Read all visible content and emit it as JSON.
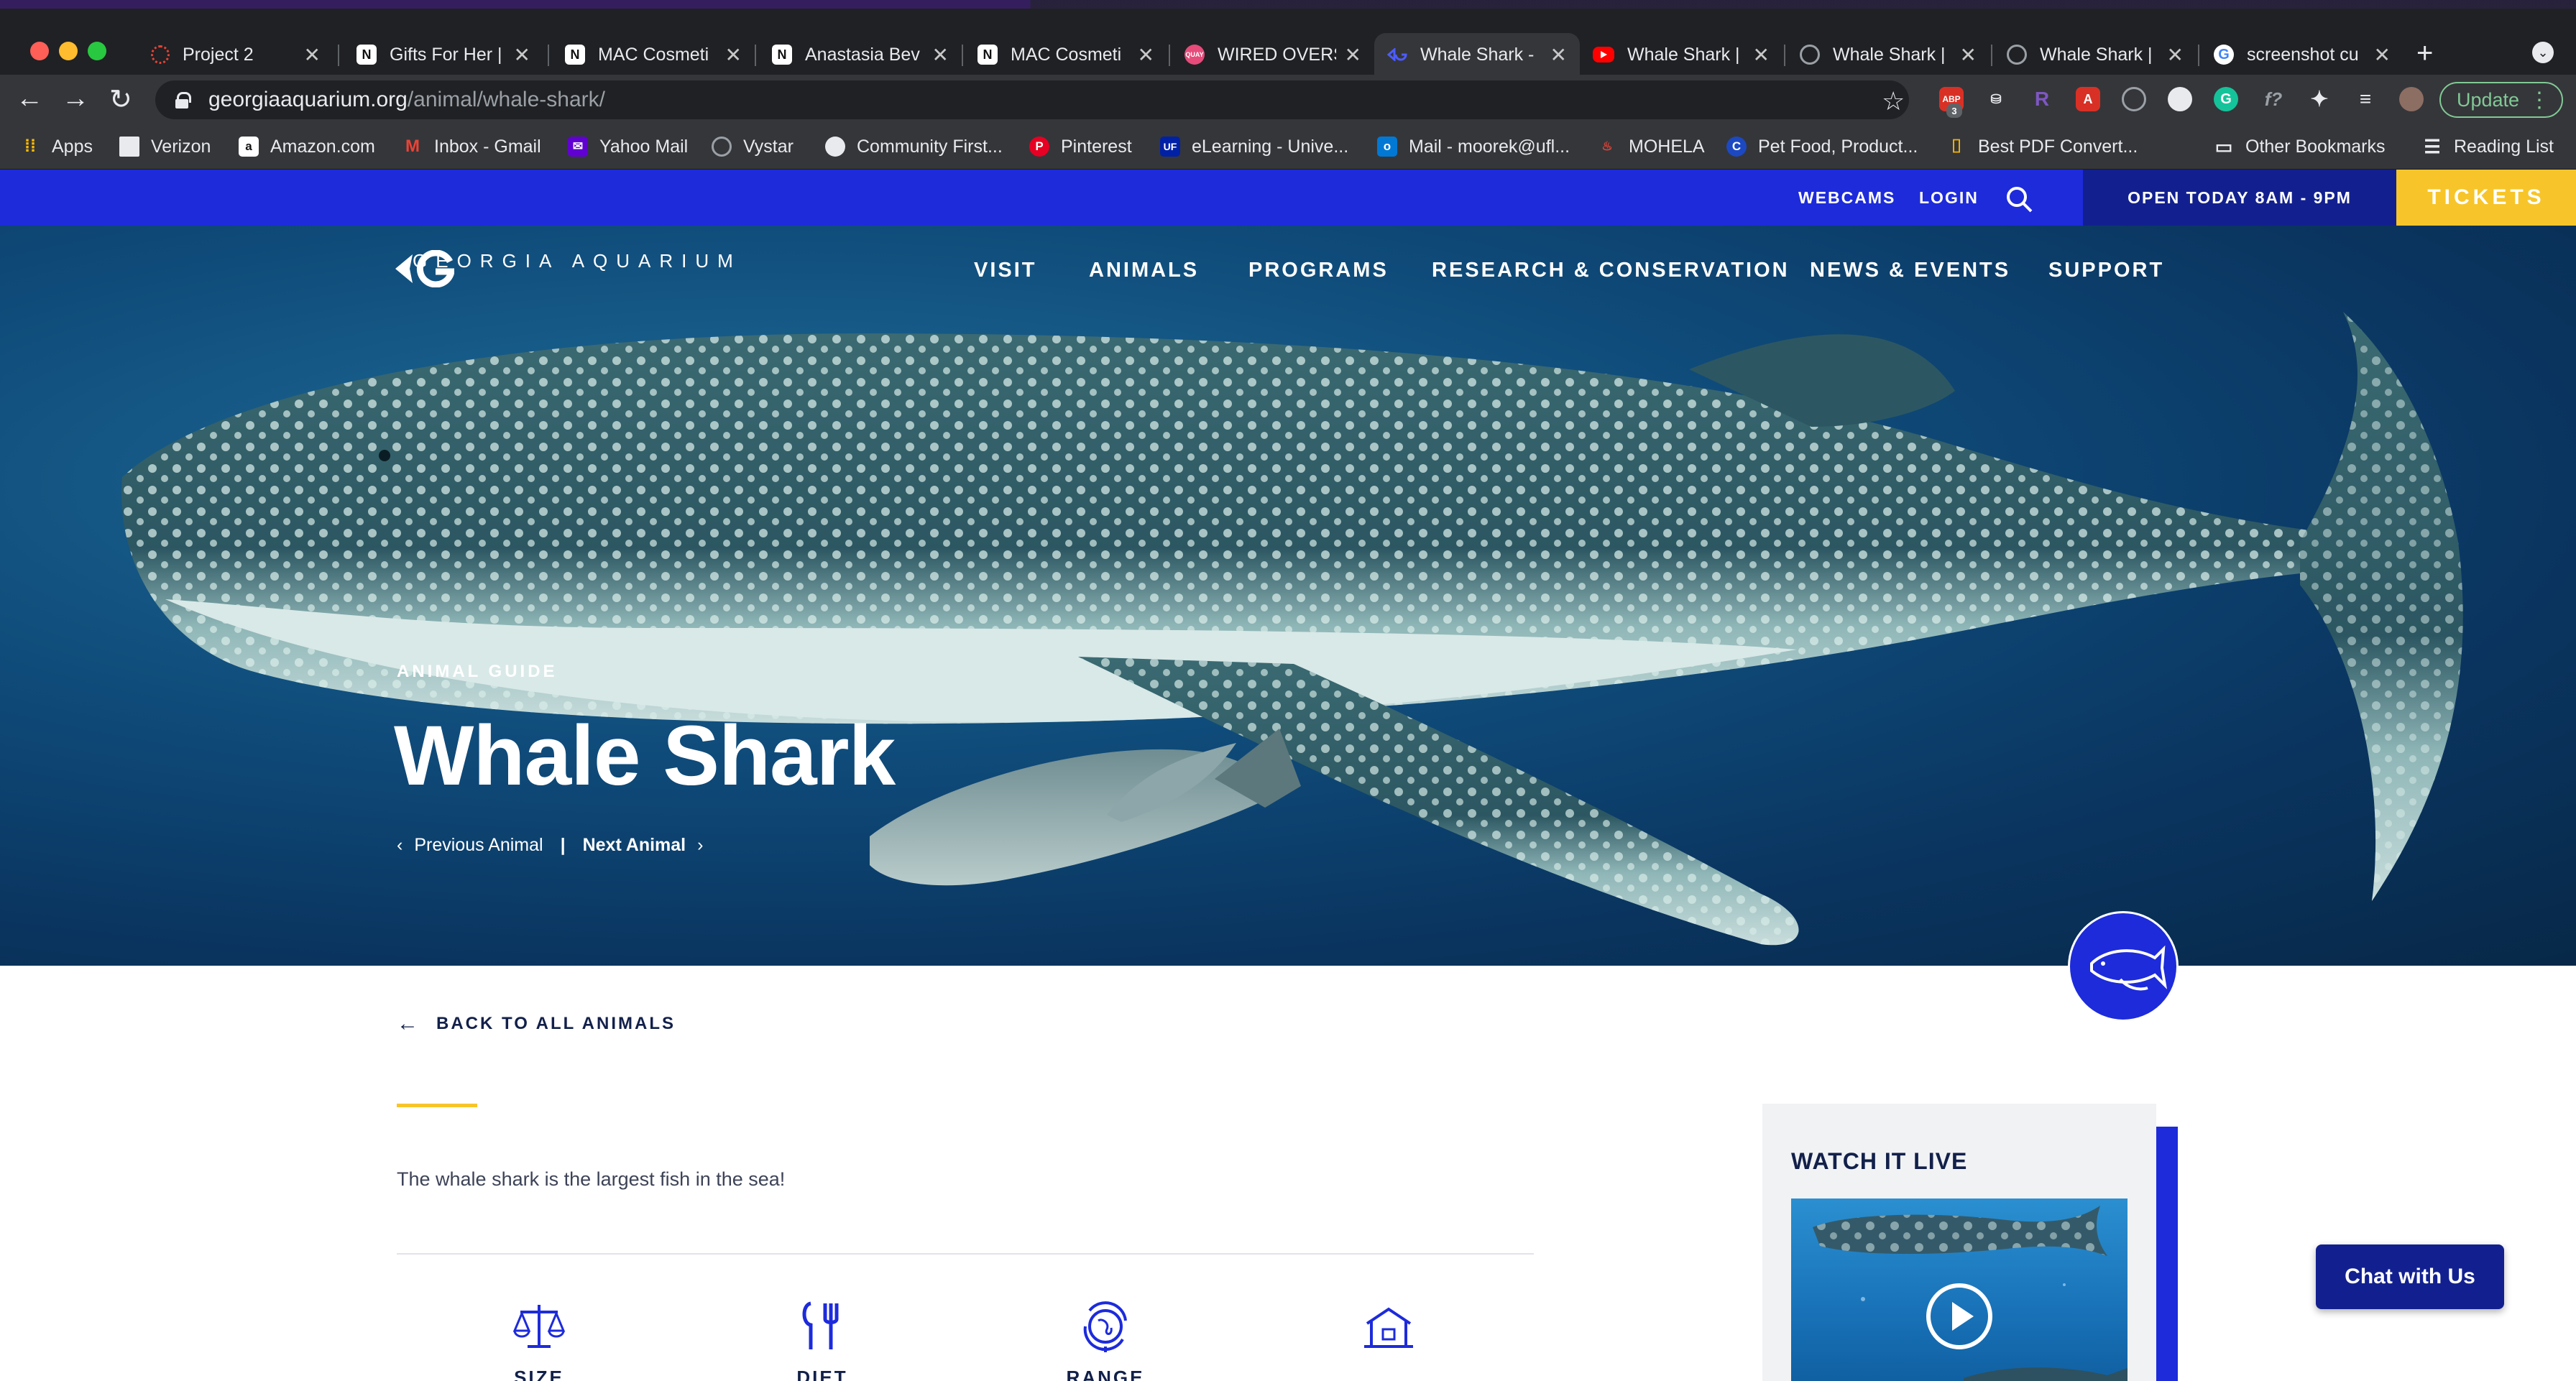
{
  "browser": {
    "tabs": [
      {
        "title": "Project 2",
        "favicon": "project-icon",
        "color": "#e94235",
        "active": false
      },
      {
        "title": "Gifts For Her |",
        "favicon": "N",
        "color": "#111111",
        "active": false
      },
      {
        "title": "MAC Cosmeti",
        "favicon": "N",
        "color": "#111111",
        "active": false
      },
      {
        "title": "Anastasia Bev",
        "favicon": "N",
        "color": "#111111",
        "active": false
      },
      {
        "title": "MAC Cosmeti",
        "favicon": "N",
        "color": "#111111",
        "active": false
      },
      {
        "title": "WIRED OVERS",
        "favicon": "QUAY",
        "color": "#e64b7a",
        "active": false
      },
      {
        "title": "Whale Shark -",
        "favicon": "ga-icon",
        "color": "#1d2bdb",
        "active": true
      },
      {
        "title": "Whale Shark |",
        "favicon": "youtube-icon",
        "color": "#ff0000",
        "active": false
      },
      {
        "title": "Whale Shark |",
        "favicon": "globe-icon",
        "color": "#9aa0a6",
        "active": false
      },
      {
        "title": "Whale Shark |",
        "favicon": "globe-icon",
        "color": "#9aa0a6",
        "active": false
      },
      {
        "title": "screenshot cu",
        "favicon": "google-icon",
        "color": "#4285f4",
        "active": false
      }
    ],
    "tab_close": "✕",
    "new_tab": "+",
    "url_host": "georgiaaquarium.org",
    "url_path": "/animal/whale-shark/",
    "update_label": "Update",
    "ext_badge": "3",
    "bookmarks": [
      {
        "label": "Apps",
        "icon": "apps-grid-icon",
        "color": "#4285f4"
      },
      {
        "label": "Verizon",
        "icon": "verizon-icon",
        "color": "#d52b1e"
      },
      {
        "label": "Amazon.com",
        "icon": "amazon-icon",
        "color": "#111111"
      },
      {
        "label": "Inbox - Gmail",
        "icon": "gmail-icon",
        "color": "#ea4335"
      },
      {
        "label": "Yahoo Mail",
        "icon": "yahoo-icon",
        "color": "#6001d2"
      },
      {
        "label": "Vystar",
        "icon": "vystar-icon",
        "color": "#5f6368"
      },
      {
        "label": "Community First...",
        "icon": "globe-icon",
        "color": "#5f6368"
      },
      {
        "label": "Pinterest",
        "icon": "pinterest-icon",
        "color": "#e60023"
      },
      {
        "label": "eLearning - Unive...",
        "icon": "uf-icon",
        "color": "#0021a5"
      },
      {
        "label": "Mail - moorek@ufl...",
        "icon": "outlook-icon",
        "color": "#0078d4"
      },
      {
        "label": "MOHELA",
        "icon": "mohela-icon",
        "color": "#ffffff"
      },
      {
        "label": "Pet Food, Product...",
        "icon": "chewy-icon",
        "color": "#1c49c2"
      },
      {
        "label": "Best PDF Convert...",
        "icon": "pdf-icon",
        "color": "#f4b400"
      }
    ],
    "other_bookmarks": "Other Bookmarks",
    "reading_list": "Reading List"
  },
  "site": {
    "util_links": {
      "webcams": "WEBCAMS",
      "login": "LOGIN"
    },
    "hours": "OPEN TODAY 8AM - 9PM",
    "tickets": "TICKETS",
    "logo_text": "GEORGIA AQUARIUM",
    "nav": [
      "VISIT",
      "ANIMALS",
      "PROGRAMS",
      "RESEARCH & CONSERVATION",
      "NEWS & EVENTS",
      "SUPPORT"
    ],
    "eyebrow": "ANIMAL GUIDE",
    "title": "Whale Shark",
    "prev_animal": "Previous Animal",
    "next_animal": "Next Animal",
    "divider": "|",
    "back_link": "BACK TO ALL ANIMALS",
    "intro": "The whale shark is the largest fish in the sea!",
    "facts": [
      "SIZE",
      "DIET",
      "RANGE",
      ""
    ],
    "live_title": "WATCH IT LIVE",
    "chat": "Chat with Us",
    "colors": {
      "brand_blue": "#1d2bdb",
      "dark_blue": "#12208f",
      "yellow": "#f7c52a",
      "navy_text": "#12204a"
    }
  }
}
